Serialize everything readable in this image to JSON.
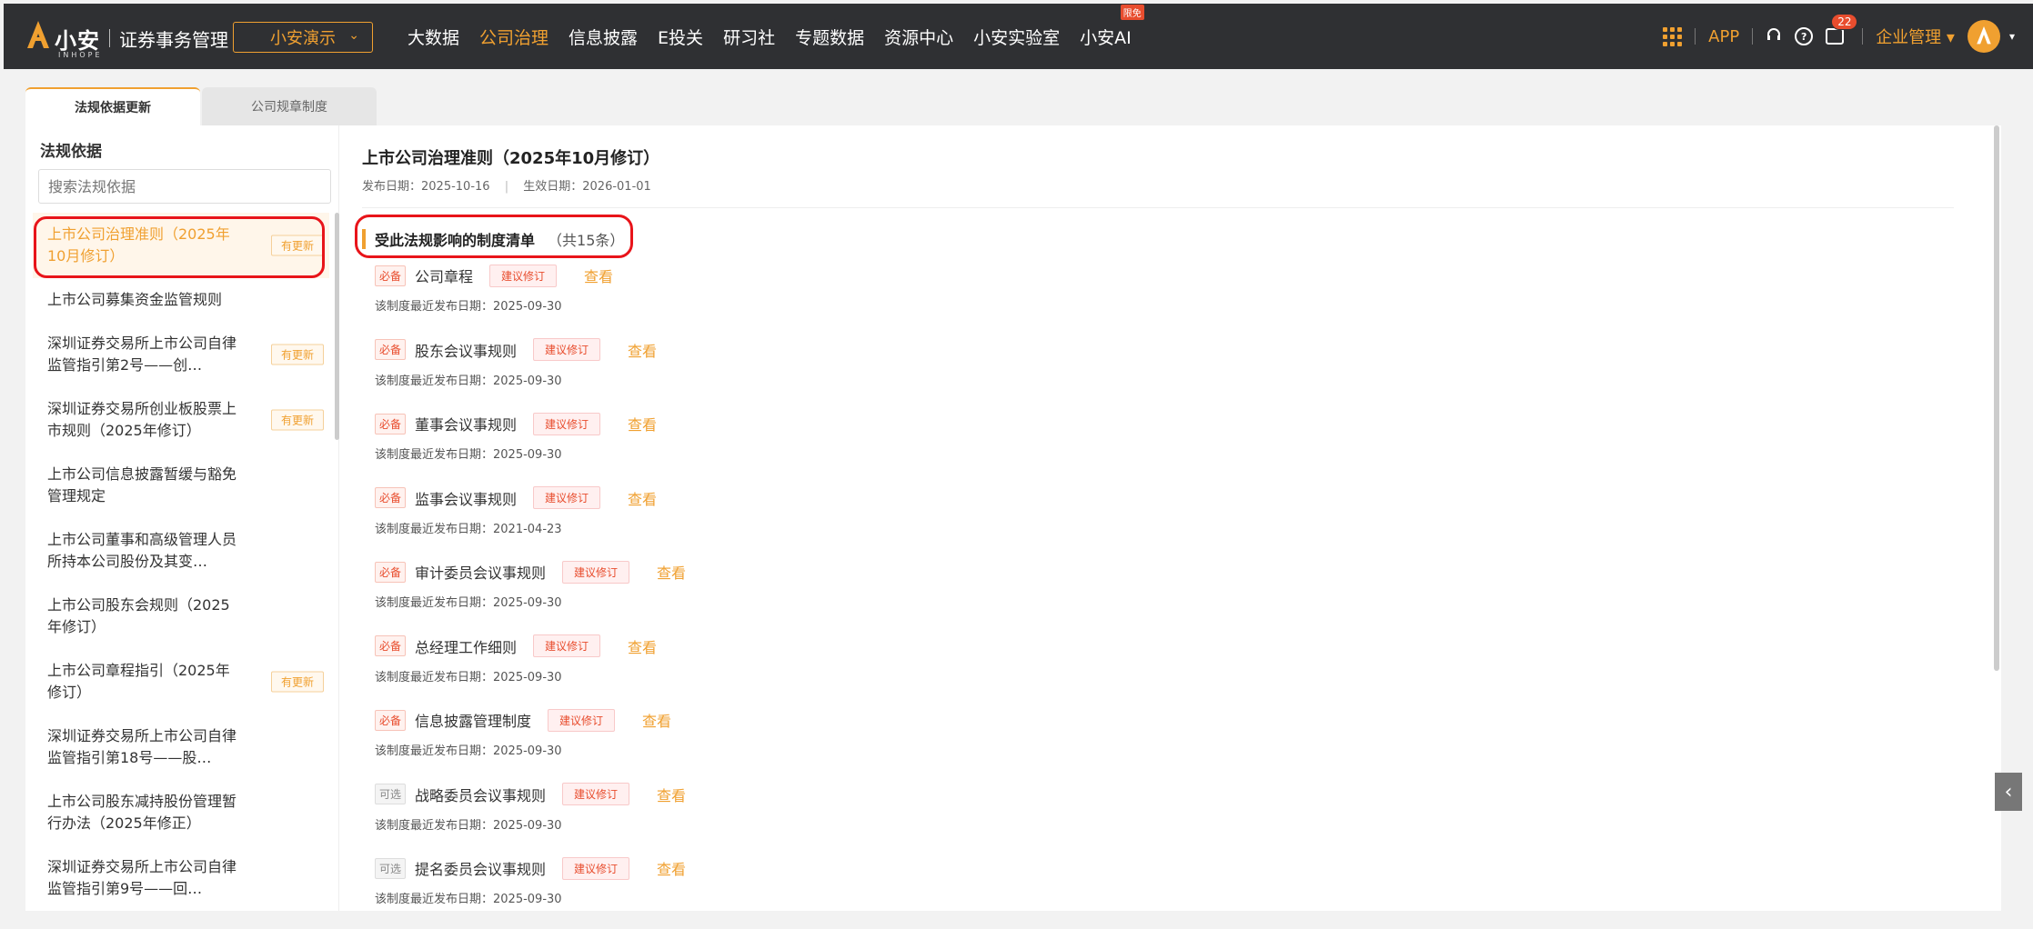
{
  "header": {
    "brand": "小安",
    "brand_sub": "INHOPE",
    "product": "证券事务管理",
    "company": "小安演示",
    "nav": [
      {
        "label": "大数据",
        "active": false
      },
      {
        "label": "公司治理",
        "active": true
      },
      {
        "label": "信息披露",
        "active": false
      },
      {
        "label": "E投关",
        "active": false
      },
      {
        "label": "研习社",
        "active": false
      },
      {
        "label": "专题数据",
        "active": false
      },
      {
        "label": "资源中心",
        "active": false
      },
      {
        "label": "小安实验室",
        "active": false
      },
      {
        "label": "小安AI",
        "active": false,
        "badge": "限免"
      }
    ],
    "app_label": "APP",
    "message_count": "22",
    "org_menu": "企业管理",
    "help_glyph": "?"
  },
  "tabs": [
    {
      "label": "法规依据更新",
      "active": true
    },
    {
      "label": "公司规章制度",
      "active": false
    }
  ],
  "sidebar": {
    "title": "法规依据",
    "search_placeholder": "搜索法规依据",
    "update_badge": "有更新",
    "items": [
      {
        "label": "上市公司治理准则（2025年10月修订）",
        "updated": true,
        "selected": true
      },
      {
        "label": "上市公司募集资金监管规则",
        "updated": false
      },
      {
        "label": "深圳证券交易所上市公司自律监管指引第2号——创…",
        "updated": true
      },
      {
        "label": "深圳证券交易所创业板股票上市规则（2025年修订）",
        "updated": true
      },
      {
        "label": "上市公司信息披露暂缓与豁免管理规定",
        "updated": false
      },
      {
        "label": "上市公司董事和高级管理人员所持本公司股份及其变…",
        "updated": false
      },
      {
        "label": "上市公司股东会规则（2025年修订）",
        "updated": false
      },
      {
        "label": "上市公司章程指引（2025年修订）",
        "updated": true
      },
      {
        "label": "深圳证券交易所上市公司自律监管指引第18号——股…",
        "updated": false
      },
      {
        "label": "上市公司股东减持股份管理暂行办法（2025年修正）",
        "updated": false
      },
      {
        "label": "深圳证券交易所上市公司自律监管指引第9号——回…",
        "updated": false
      }
    ]
  },
  "document": {
    "title": "上市公司治理准则（2025年10月修订）",
    "publish_label": "发布日期：",
    "publish_date": "2025-10-16",
    "effective_label": "生效日期：",
    "effective_date": "2026-01-01",
    "affected_title": "受此法规影响的制度清单",
    "affected_count": "（共15条）",
    "suggest_label": "建议修订",
    "view_label": "查看",
    "date_label": "该制度最近发布日期：",
    "regulations": [
      {
        "tag": "必备",
        "required": true,
        "name": "公司章程",
        "date": "2025-09-30"
      },
      {
        "tag": "必备",
        "required": true,
        "name": "股东会议事规则",
        "date": "2025-09-30"
      },
      {
        "tag": "必备",
        "required": true,
        "name": "董事会议事规则",
        "date": "2025-09-30"
      },
      {
        "tag": "必备",
        "required": true,
        "name": "监事会议事规则",
        "date": "2021-04-23"
      },
      {
        "tag": "必备",
        "required": true,
        "name": "审计委员会议事规则",
        "date": "2025-09-30"
      },
      {
        "tag": "必备",
        "required": true,
        "name": "总经理工作细则",
        "date": "2025-09-30"
      },
      {
        "tag": "必备",
        "required": true,
        "name": "信息披露管理制度",
        "date": "2025-09-30"
      },
      {
        "tag": "可选",
        "required": false,
        "name": "战略委员会议事规则",
        "date": "2025-09-30"
      },
      {
        "tag": "可选",
        "required": false,
        "name": "提名委员会议事规则",
        "date": "2025-09-30"
      }
    ]
  },
  "colors": {
    "accent": "#f0a030",
    "danger": "#e84d2e",
    "highlight": "#e8141a",
    "topbar": "#2f3033"
  },
  "icons": [
    "logo-icon",
    "apps-grid-icon",
    "headset-icon",
    "help-icon",
    "message-icon",
    "chevron-down-icon",
    "collapse-left-icon"
  ]
}
